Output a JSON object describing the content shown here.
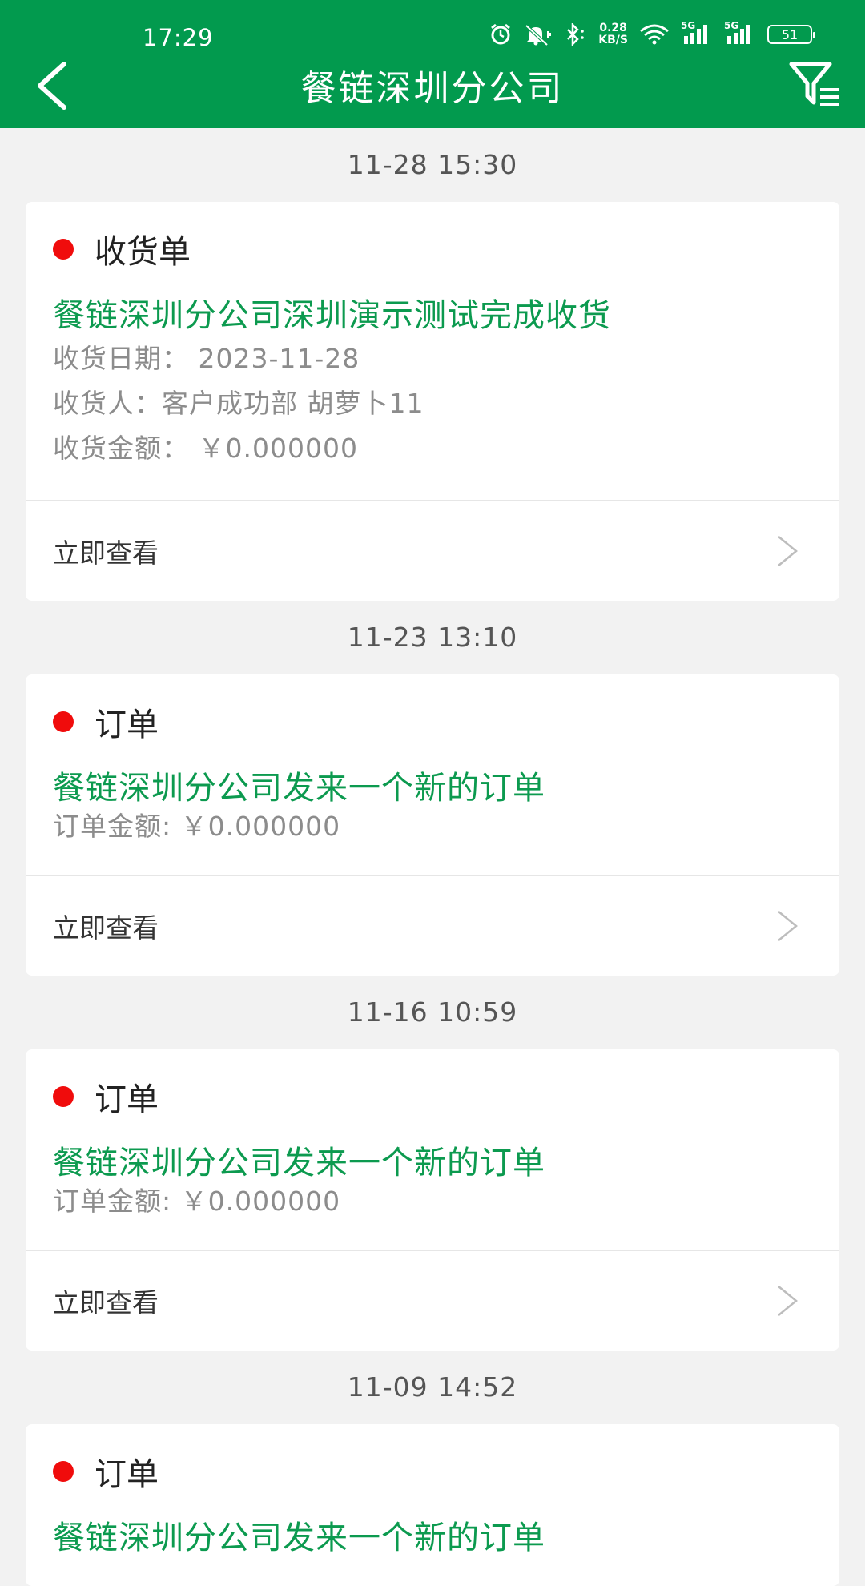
{
  "status_bar": {
    "time": "17:29",
    "net_speed_value": "0.28",
    "net_speed_unit": "KB/S",
    "signal1_label": "5G",
    "signal2_label": "5G",
    "battery": "51"
  },
  "header": {
    "title": "餐链深圳分公司",
    "back_icon": "back-arrow-icon",
    "filter_icon": "filter-list-icon",
    "background_color": "#029a4e"
  },
  "messages": [
    {
      "time": "11-28 15:30",
      "type": "收货单",
      "title": "餐链深圳分公司深圳演示测试完成收货",
      "details": [
        "收货日期： 2023-11-28",
        "收货人：客户成功部 胡萝卜11",
        "收货金额： ￥0.000000"
      ],
      "action": "立即查看"
    },
    {
      "time": "11-23 13:10",
      "type": "订单",
      "title": "餐链深圳分公司发来一个新的订单",
      "details": [
        "订单金额: ￥0.000000"
      ],
      "action": "立即查看"
    },
    {
      "time": "11-16 10:59",
      "type": "订单",
      "title": "餐链深圳分公司发来一个新的订单",
      "details": [
        "订单金额: ￥0.000000"
      ],
      "action": "立即查看"
    },
    {
      "time": "11-09 14:52",
      "type": "订单",
      "title": "餐链深圳分公司发来一个新的订单",
      "details": [],
      "action": ""
    }
  ],
  "colors": {
    "accent_green": "#0c9a4f",
    "unread_dot": "#f00c0c",
    "page_background": "#f2f2f2"
  }
}
